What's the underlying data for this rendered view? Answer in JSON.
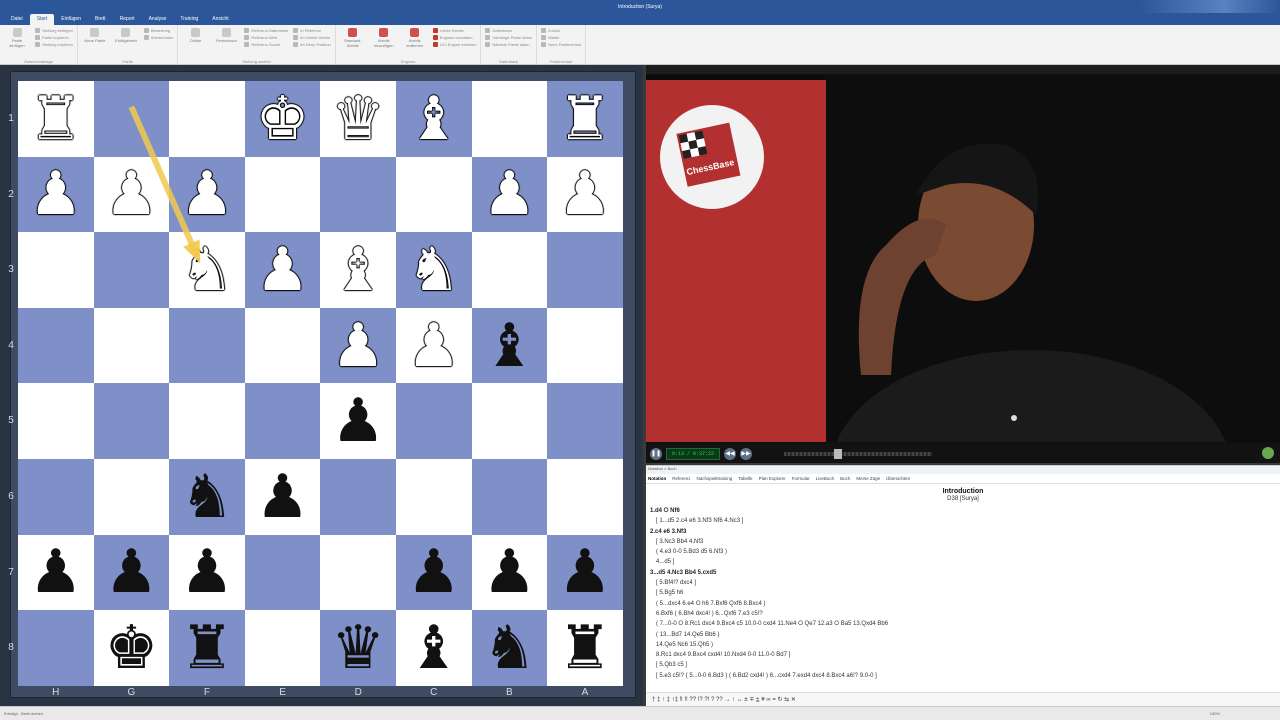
{
  "window": {
    "title": "Introduction (Surya)"
  },
  "menu": {
    "tabs": [
      "Datei",
      "Start",
      "Einfügen",
      "Brett",
      "Report",
      "Analyse",
      "Training",
      "Ansicht"
    ],
    "active": 1
  },
  "ribbon": {
    "groups": [
      {
        "label": "Zwischenablage",
        "items": [
          "Stellung einfügen",
          "Partie kopieren",
          "Stellung kopieren"
        ],
        "big": [
          "Partie einfügen"
        ]
      },
      {
        "label": "Partie",
        "items": [
          "Bewertung",
          "Wiederholen"
        ],
        "big": [
          "Neue Partie",
          "Einfügebrett"
        ]
      },
      {
        "label": "Stellung suchen",
        "items": [
          "Referenz-Datenbank",
          "Referenz-Web",
          "Referenz-Suche",
          "In Referenz",
          "Im Online-Verein",
          "Im Deep Position"
        ],
        "big": [
          "Online",
          "Fernschach"
        ]
      },
      {
        "label": "Engines",
        "items": [
          "Letzte Kiebitz",
          "Engines verwalten",
          "UCI Engine erstellen"
        ],
        "big": [
          "Standard-Kiebitz",
          "Kiebitz hinzufügen",
          "Kiebitz entfernen"
        ]
      },
      {
        "label": "Datenbank",
        "items": [
          "Datenbank",
          "Vorherige Partie laden",
          "Nächste Partie laden"
        ],
        "big": []
      },
      {
        "label": "Partieverlauf",
        "items": [
          "Zurück",
          "Weiter",
          "Neue Partieverlauf"
        ],
        "big": []
      }
    ]
  },
  "board": {
    "ranks": [
      "1",
      "2",
      "3",
      "4",
      "5",
      "6",
      "7",
      "8"
    ],
    "files": [
      "H",
      "G",
      "F",
      "E",
      "D",
      "C",
      "B",
      "A"
    ],
    "rows": [
      [
        [
          "♜",
          "w"
        ],
        null,
        null,
        [
          "♚",
          "w"
        ],
        [
          "♛",
          "w"
        ],
        [
          "♝",
          "w"
        ],
        null,
        [
          "♜",
          "w"
        ]
      ],
      [
        [
          "♟",
          "w"
        ],
        [
          "♟",
          "w"
        ],
        [
          "♟",
          "w"
        ],
        null,
        null,
        null,
        [
          "♟",
          "w"
        ],
        [
          "♟",
          "w"
        ]
      ],
      [
        null,
        null,
        [
          "♞",
          "w"
        ],
        [
          "♟",
          "w"
        ],
        [
          "♝",
          "w"
        ],
        [
          "♞",
          "w"
        ],
        null,
        null
      ],
      [
        null,
        null,
        null,
        null,
        [
          "♟",
          "w"
        ],
        [
          "♟",
          "w"
        ],
        [
          "♝",
          "b"
        ],
        null
      ],
      [
        null,
        null,
        null,
        null,
        [
          "♟",
          "b"
        ],
        null,
        null,
        null
      ],
      [
        null,
        null,
        [
          "♞",
          "b"
        ],
        [
          "♟",
          "b"
        ],
        null,
        null,
        null,
        null
      ],
      [
        [
          "♟",
          "b"
        ],
        [
          "♟",
          "b"
        ],
        [
          "♟",
          "b"
        ],
        null,
        null,
        [
          "♟",
          "b"
        ],
        [
          "♟",
          "b"
        ],
        [
          "♟",
          "b"
        ]
      ],
      [
        null,
        [
          "♚",
          "b"
        ],
        [
          "♜",
          "b"
        ],
        null,
        [
          "♛",
          "b"
        ],
        [
          "♝",
          "b"
        ],
        [
          "♞",
          "b"
        ],
        [
          "♜",
          "b"
        ]
      ]
    ],
    "arrow": {
      "from": "G1",
      "to": "F3",
      "color": "#f2c94c"
    }
  },
  "video": {
    "label": "ChessBase",
    "timecode": "0:13 / 0:37:22",
    "progress": 0.36
  },
  "notation": {
    "header": "Notation × Buch",
    "tabs": [
      "Notation",
      "Referenz",
      "Nachspielttraining",
      "Tabelle",
      "Plan Explorer",
      "Formular",
      "LiveBuch",
      "Buch",
      "Meine Züge",
      "Übersichten"
    ],
    "title": "Introduction",
    "subtitle": "D38 [Surya]",
    "lines": [
      {
        "text": "1.d4 ⭘ Nf6",
        "bold": true
      },
      {
        "text": "[ 1...d5 2.c4 e6 3.Nf3 Nf6 4.Nc3 ]",
        "bold": false
      },
      {
        "text": "2.c4 e6 3.Nf3",
        "bold": true
      },
      {
        "text": "[ 3.Nc3 Bb4 4.Nf3",
        "bold": false
      },
      {
        "text": "( 4.e3 0-0 5.Bd3 d5 6.Nf3 )",
        "bold": false
      },
      {
        "text": "4...d5 ]",
        "bold": false
      },
      {
        "text": "3...d5 4.Nc3 Bb4 5.cxd5",
        "bold": true
      },
      {
        "text": "[ 5.Bf4!? dxc4 ]",
        "bold": false
      },
      {
        "text": "[ 5.Bg5 h6",
        "bold": false
      },
      {
        "text": "( 5...dxc4 6.e4 ⭘ h6 7.Bxf6 Qxf6 8.Bxc4 )",
        "bold": false
      },
      {
        "text": "6.Bxf6 ( 6.Bh4 dxc4! ) 6...Qxf6 7.e3 c5!?",
        "bold": false
      },
      {
        "text": "( 7...0-0 ⭘ 8.Rc1 dxc4 9.Bxc4 c5 10.0-0 cxd4 11.Ne4 ⭘ Qe7 12.a3 ⭘ Ba5 13.Qxd4 Bb6",
        "bold": false
      },
      {
        "text": "( 13...Bd7 14.Qe5 Bb6 )",
        "bold": false
      },
      {
        "text": "14.Qe5 Nc6 15.Qh5 )",
        "bold": false
      },
      {
        "text": "8.Rc1 dxc4 9.Bxc4 cxd4! 10.Nxd4 0-0 11.0-0 Bd7 ]",
        "bold": false
      },
      {
        "text": "[ 5.Qb3 c5 ]",
        "bold": false
      },
      {
        "text": "[ 5.e3 c5!? ( 5...0-0 6.Bd3 ) ( 6.Bd2 cxd4! ) 6...cxd4 7.exd4 dxc4 8.Bxc4 a6!? 9.0-0 ]",
        "bold": false
      }
    ],
    "toolbar": "† ‡ ↑ ‡ ↑‡ ‼ !! ?? !? ?! ? ?? → ↑ ↔ ± ∓ ⩲ ⩱ ∞ = ↻ ⇆ ✕"
  },
  "status": {
    "text": "Erledigt - Brett drehen",
    "zoom": "100%"
  },
  "colors": {
    "light_square": "#ffffff",
    "dark_square": "#7f8fc8",
    "accent": "#2b579a",
    "arrow": "#f2c94c"
  }
}
